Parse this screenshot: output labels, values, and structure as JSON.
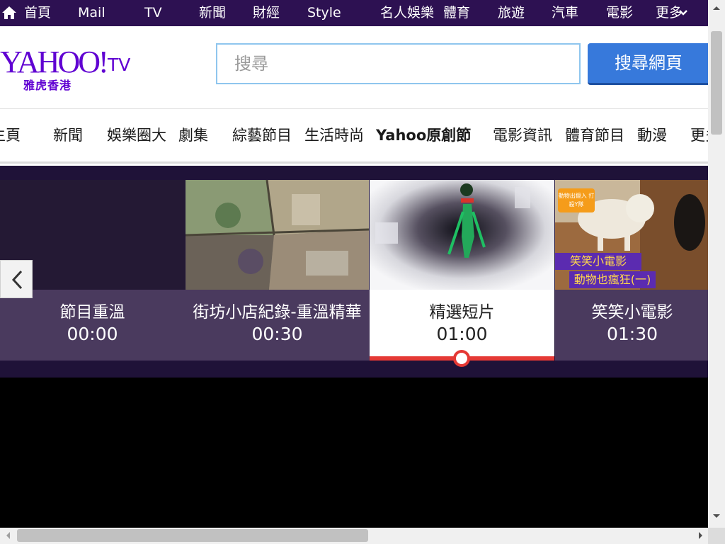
{
  "topnav": {
    "items": [
      "首頁",
      "Mail",
      "TV",
      "新聞",
      "財經",
      "Style",
      "名人娛樂",
      "體育",
      "旅遊",
      "汽車",
      "電影",
      "更多"
    ]
  },
  "header": {
    "logo_main": "YAHOO!",
    "logo_tv": "TV",
    "logo_sub": "雅虎香港",
    "search_placeholder": "搜尋",
    "search_button": "搜尋網頁"
  },
  "categories": [
    "主頁",
    "新聞",
    "娛樂圈大",
    "劇集",
    "綜藝節目",
    "生活時尚",
    "Yahoo原創節",
    "電影資訊",
    "體育節目",
    "動漫",
    "更多"
  ],
  "schedule": [
    {
      "title": "節目重溫",
      "time": "00:00"
    },
    {
      "title": "街坊小店紀錄-重溫精華",
      "time": "00:30"
    },
    {
      "title": "精選短片",
      "time": "01:00",
      "active": true
    },
    {
      "title": "笑笑小電影",
      "time": "01:30"
    }
  ],
  "thumb_captions": {
    "t4_badge": "動物出鏡入 打殺Y隊",
    "t4_line1": "笑笑小電影",
    "t4_line2": "動物也瘋狂(一)"
  },
  "colors": {
    "topnav_bg": "#2d1152",
    "brand_purple": "#6001d2",
    "search_btn": "#3779db",
    "strip_bg": "#1f1238",
    "card_bg": "#4a3a5e",
    "active_bar": "#e53935"
  }
}
